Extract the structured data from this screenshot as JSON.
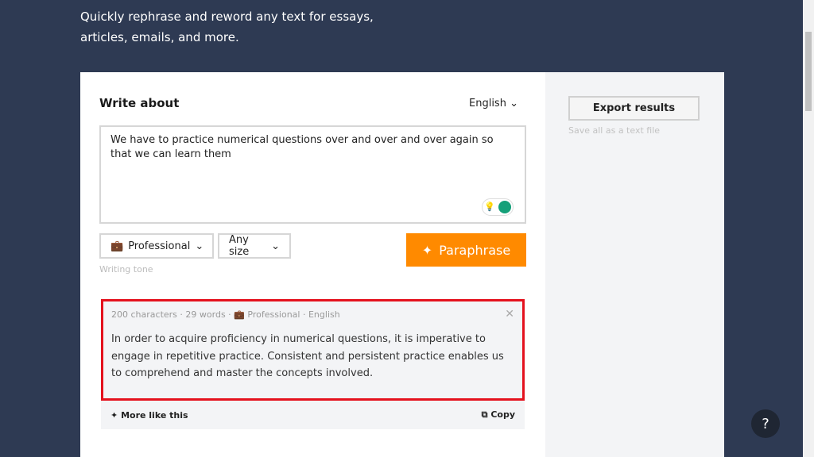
{
  "header": {
    "subtitle": "Quickly rephrase and reword any text for essays, articles, emails, and more."
  },
  "editor": {
    "title": "Write about",
    "language": "English",
    "input_text": "We have to practice numerical questions over and over and over again so that we can learn them",
    "grammarly_badge": "1"
  },
  "controls": {
    "tone": "Professional",
    "size": "Any size",
    "tone_label": "Writing tone",
    "paraphrase": "Paraphrase"
  },
  "result": {
    "characters": "200 characters",
    "words": "29 words",
    "tone": "Professional",
    "language": "English",
    "text": "In order to acquire proficiency in numerical questions, it is imperative to engage in repetitive practice. Consistent and persistent practice enables us to comprehend and master the concepts involved.",
    "more": "More like this",
    "copy": "Copy"
  },
  "sidebar": {
    "export": "Export results",
    "export_hint": "Save all as a text file"
  },
  "help": "?"
}
